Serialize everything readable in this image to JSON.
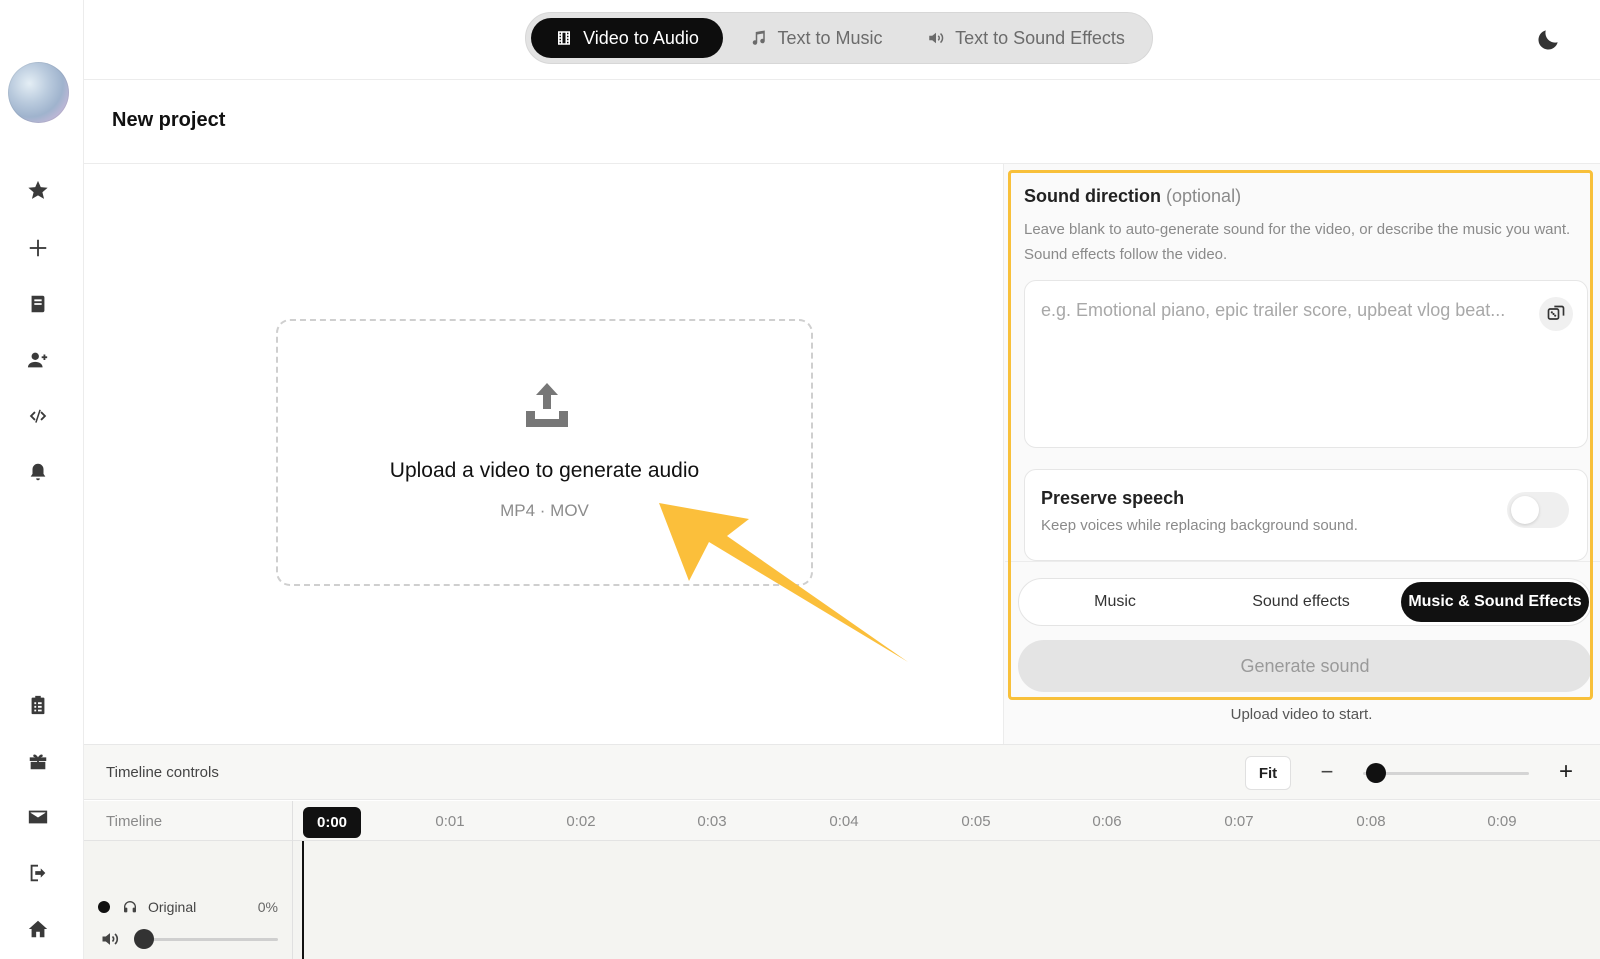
{
  "top_tabs": [
    {
      "label": "Video to Audio",
      "icon": "film-icon",
      "active": true
    },
    {
      "label": "Text to Music",
      "icon": "music-note-icon",
      "active": false
    },
    {
      "label": "Text to Sound Effects",
      "icon": "speaker-icon",
      "active": false
    }
  ],
  "project": {
    "title": "New project"
  },
  "upload": {
    "title": "Upload a video to generate audio",
    "formats": "MP4 · MOV"
  },
  "sound_direction": {
    "title": "Sound direction",
    "optional": "(optional)",
    "description": "Leave blank to auto-generate sound for the video, or describe the music you want. Sound effects follow the video.",
    "placeholder": "e.g. Emotional piano, epic trailer score, upbeat vlog beat...",
    "value": ""
  },
  "preserve_speech": {
    "title": "Preserve speech",
    "subtitle": "Keep voices while replacing background sound.",
    "enabled": false
  },
  "mode_tabs": [
    {
      "label": "Music",
      "active": false
    },
    {
      "label": "Sound effects",
      "active": false
    },
    {
      "label": "Music & Sound Effects",
      "active": true
    }
  ],
  "generate": {
    "label": "Generate sound",
    "hint": "Upload video to start."
  },
  "timeline_controls": {
    "label": "Timeline controls",
    "fit_label": "Fit",
    "minus": "−",
    "plus": "+"
  },
  "timeline": {
    "label": "Timeline",
    "current": "0:00",
    "ticks": [
      "0:01",
      "0:02",
      "0:03",
      "0:04",
      "0:05",
      "0:06",
      "0:07",
      "0:08",
      "0:09"
    ]
  },
  "track": {
    "name": "Original",
    "volume": "0%"
  },
  "colors": {
    "highlight": "#f8c03a",
    "accent": "#111111",
    "arrow": "#fbbf3b"
  }
}
